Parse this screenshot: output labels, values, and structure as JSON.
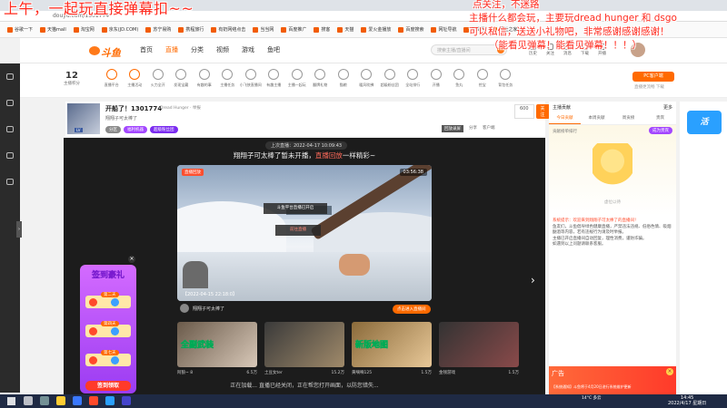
{
  "overlay": {
    "left_text": "上午，一起玩直接弹幕扣~~",
    "right_lines": [
      "点关注，不迷路",
      "主播什么都会玩，主要玩dread hunger 和 dsgo",
      "可以私信，送送小礼物吧，非常感谢感谢感谢！",
      "（能看见弹幕！能看见弹幕！！！）"
    ]
  },
  "browser": {
    "url": "douyu.com/1301774",
    "bookmarks": [
      "谷歌一下",
      "天猫mall",
      "淘宝网",
      "京东(JD.COM)",
      "苏宁易购",
      "携程旅行",
      "有奶网络点击",
      "当当网",
      "百度推广",
      "搜客",
      "天猫",
      "爱火金播放",
      "百度搜索",
      "网址导航",
      "新闻网",
      "网址之家"
    ]
  },
  "header": {
    "logo_text": "斗鱼",
    "nav": [
      "首页",
      "直播",
      "分类",
      "视频",
      "游戏",
      "鱼吧"
    ],
    "search_placeholder": "搜索主播/直播间",
    "icons": [
      "历史",
      "关注",
      "消息",
      "下载",
      "开播"
    ]
  },
  "catbar": {
    "num": "12",
    "num_label": "主播积分",
    "items": [
      "直播平台",
      "主播活动",
      "火力全开",
      "发现宝藏",
      "有趣的事",
      "主播任务",
      "小飞侠直播间",
      "有趣主播",
      "主播一起玩",
      "翻牌礼物",
      "猫粮",
      "暖风吹拂",
      "超级粉丝团",
      "全站排行",
      "开播",
      "鱼丸",
      "挖宝",
      "背包任务"
    ],
    "pc_button": "PC客户端",
    "pc_sub": "直播更流畅 下载"
  },
  "room": {
    "title": "开船了！1301774",
    "category": "Dread Hunger · 举报",
    "streamer": "翔翔子可太棒了",
    "badges": [
      "分区",
      "福利机器",
      "超级粉丝团"
    ],
    "right_links": [
      "回放录屏",
      "分享",
      "客户端"
    ],
    "follow_count": "600",
    "follow_label": "关注"
  },
  "player": {
    "top_tag": "上次直播：2022-04-17 10:09:43",
    "headline_a": "翔翔子可太棒了暂未开播，",
    "headline_b": "直播回放",
    "headline_c": "一样精彩~",
    "video_badge": "直播回放",
    "video_duration": "03:56:38",
    "popup_text": "斗鱼平台直播已开启",
    "popup_btn": "前往直播",
    "stamp": "【2022-04-15 22:18:0】",
    "streamer_line": "翔翔子可太棒了",
    "enter_btn": "点击进入直播间",
    "recs": [
      {
        "title": "阿狼~ 8",
        "heat": "6.5万",
        "overlay": "全副武装"
      },
      {
        "title": "土豆女ter",
        "heat": "15.2万",
        "overlay": ""
      },
      {
        "title": "黄嘀嘀125",
        "heat": "1.5万",
        "overlay": "新版地图"
      },
      {
        "title": "金钱游戏",
        "heat": "1.5万",
        "overlay": ""
      }
    ],
    "bottom_text": "正在加载... 直播已经关闭，正在帮您打开画面，以防您错失..."
  },
  "signin": {
    "title": "签到豪礼",
    "days": [
      "第二天",
      "第四天",
      "第七天"
    ],
    "claim": "签到领取"
  },
  "right_panel": {
    "head": "主播贡献",
    "head_right": "更多",
    "tabs": [
      "今日贡献",
      "本周贡献",
      "周贡榜",
      "贵宾"
    ],
    "rank_label": "贡献榜单排行",
    "rank_btn": "成为贵宾",
    "rank_caption": "虚位以待",
    "chat": [
      "系统提示：欢迎来到翔翔子可太棒了的直播间！",
      "鱼友们，斗鱼倡导绿色健康直播，严禁违法违规、低俗色情、吸烟酗酒等内容，若有违规行为请及时举报。",
      "主播已开启直播间自动回复，理性消费，谨防诈骗。",
      "如遇到以上问题请联系客服。"
    ],
    "ad_tag": "广告",
    "ad_text": "【系统通知】斗鱼将于4月20日进行系统维护更新"
  },
  "taskbar": {
    "weather": "14°C 多云",
    "time": "14:45",
    "date": "2022/4/17 星期日"
  }
}
